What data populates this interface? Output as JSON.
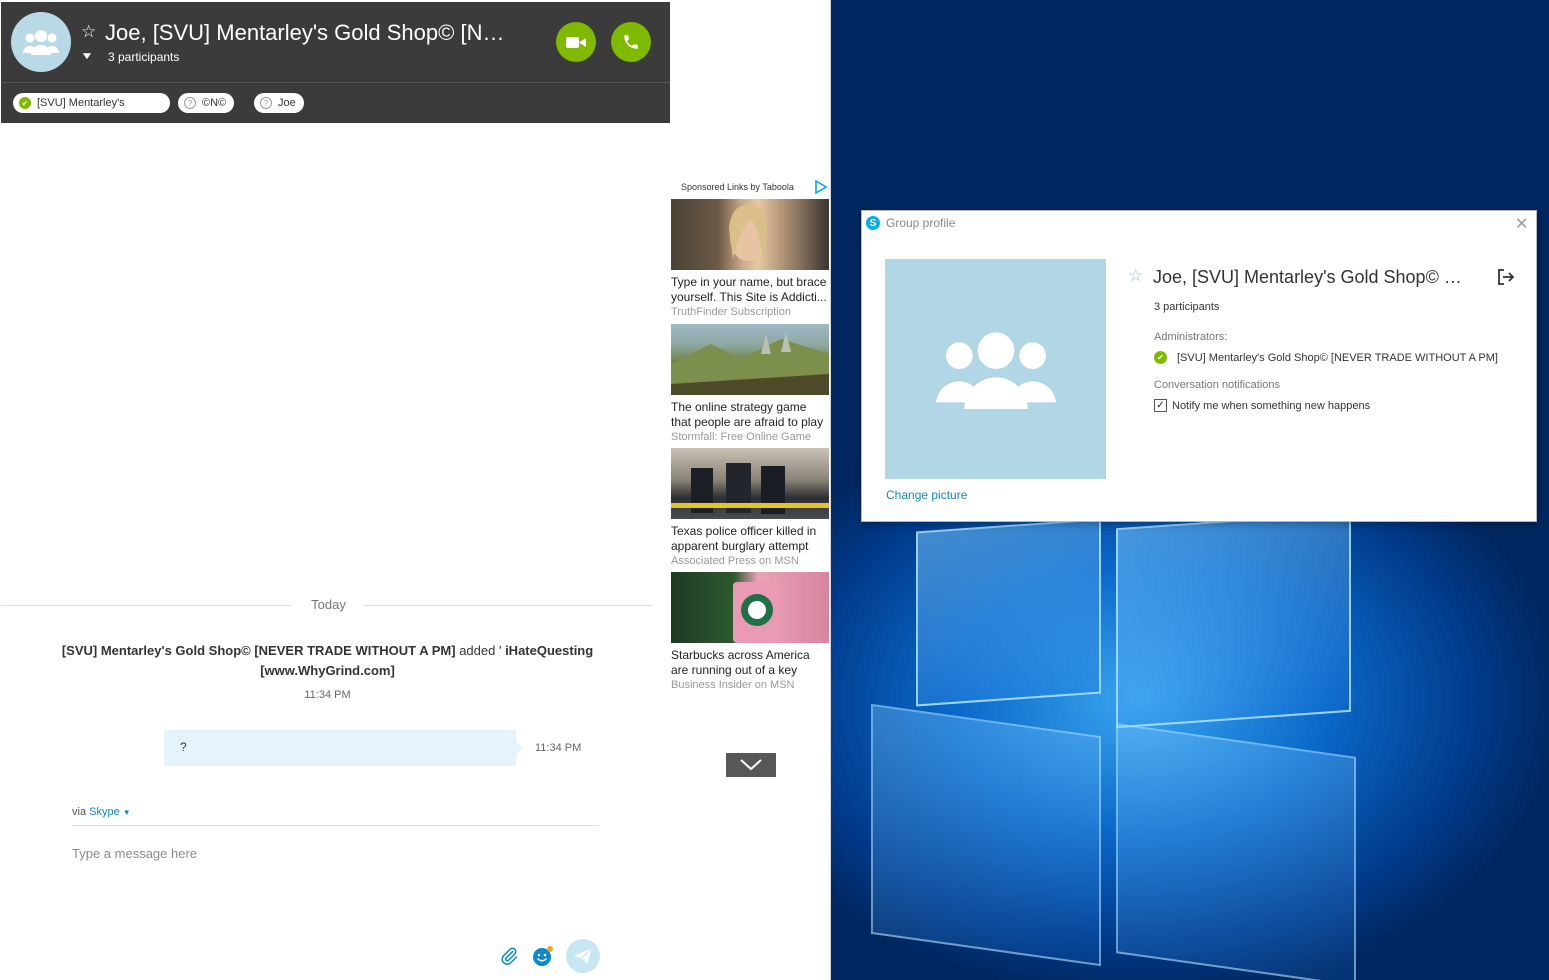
{
  "chat": {
    "title": "Joe, [SVU] Mentarley's Gold Shop© [NEVER TRADE WITHOUT A PM]",
    "participants_count": "3 participants",
    "participants": [
      {
        "name": "[SVU] Mentarley's",
        "status": "online"
      },
      {
        "name": "©N©",
        "status": "unknown"
      },
      {
        "name": "Joe",
        "status": "unknown"
      }
    ],
    "divider_label": "Today",
    "system_message": {
      "actor": "[SVU] Mentarley's Gold Shop© [NEVER TRADE WITHOUT A PM]",
      "verb": " added ' ",
      "target": "iHateQuesting [www.WhyGrind.com]",
      "time": "11:34 PM"
    },
    "message": {
      "text": "?",
      "time": "11:34 PM"
    },
    "via_prefix": "via ",
    "via_service": "Skype",
    "input_placeholder": "Type a message here"
  },
  "ads": {
    "sponsored_label": "Sponsored Links by Taboola",
    "items": [
      {
        "title": "Type in your name, but brace yourself. This Site is Addicti...",
        "source": "TruthFinder Subscription"
      },
      {
        "title": "The online strategy game that people are afraid to play",
        "source": "Stormfall: Free Online Game"
      },
      {
        "title": "Texas police officer killed in apparent burglary attempt",
        "source": "Associated Press on MSN"
      },
      {
        "title": "Starbucks across America are running out of a key ingredi...",
        "source": "Business Insider on MSN"
      }
    ]
  },
  "group_profile": {
    "window_title": "Group profile",
    "title": "Joe, [SVU] Mentarley's Gold Shop© [NEVER TRADE WITHOUT A PM]",
    "participants_count": "3 participants",
    "administrators_label": "Administrators:",
    "administrator": "[SVU] Mentarley's Gold Shop© [NEVER TRADE WITHOUT A PM]",
    "notifications_label": "Conversation notifications",
    "notify_option": "Notify me when something new happens",
    "notify_checked": true,
    "change_picture": "Change picture"
  },
  "colors": {
    "header_bg": "#3b3b3c",
    "call_green": "#7fba00",
    "skype_blue": "#00aff0",
    "link_blue": "#0a8ac9",
    "bubble_bg": "#e5f4fb",
    "avatar_bg": "#b1d6e6"
  },
  "icons": {
    "video": "video-camera-icon",
    "call": "phone-icon",
    "star": "star-icon",
    "attach": "paperclip-icon",
    "emoticon": "smiley-icon",
    "send": "send-icon",
    "leave": "leave-group-icon",
    "close": "close-icon"
  }
}
